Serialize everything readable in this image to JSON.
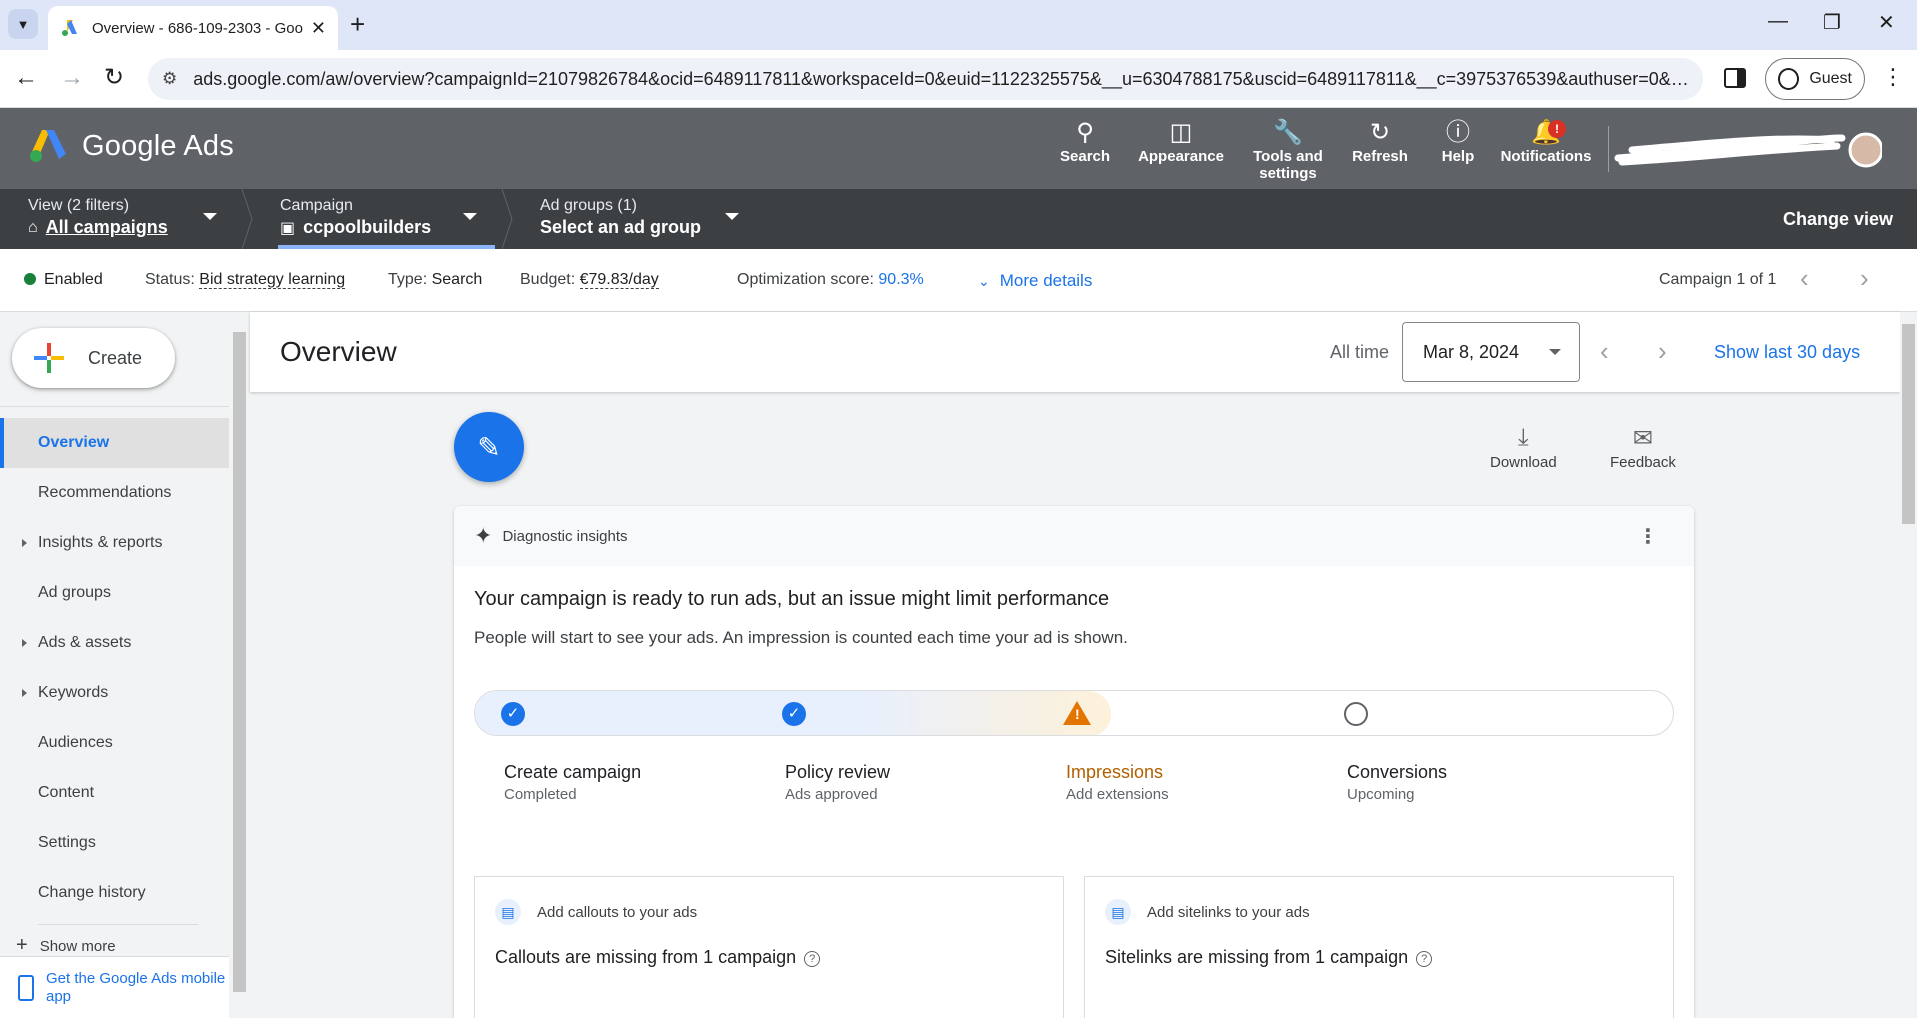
{
  "browser": {
    "tab_title": "Overview - 686-109-2303 - Goo",
    "url": "ads.google.com/aw/overview?campaignId=21079826784&ocid=6489117811&workspaceId=0&euid=1122325575&__u=6304788175&uscid=6489117811&__c=3975376539&authuser=0&sub...",
    "profile_label": "Guest"
  },
  "header": {
    "brand": "Google Ads",
    "items": [
      {
        "label": "Search",
        "icon": "search-icon"
      },
      {
        "label": "Appearance",
        "icon": "appearance-icon"
      },
      {
        "label": "Tools and settings",
        "icon": "wrench-icon"
      },
      {
        "label": "Refresh",
        "icon": "refresh-icon"
      },
      {
        "label": "Help",
        "icon": "help-icon"
      },
      {
        "label": "Notifications",
        "icon": "bell-icon",
        "badge": "!"
      }
    ]
  },
  "filters": {
    "view_label": "View (2 filters)",
    "view_value": "All campaigns",
    "campaign_label": "Campaign",
    "campaign_value": "ccpoolbuilders",
    "adgroups_label": "Ad groups (1)",
    "adgroups_value": "Select an ad group",
    "change_view": "Change view"
  },
  "status": {
    "enabled": "Enabled",
    "status_label": "Status:",
    "status_value": "Bid strategy learning",
    "type_label": "Type:",
    "type_value": "Search",
    "budget_label": "Budget:",
    "budget_value": "€79.83/day",
    "opt_label": "Optimization score:",
    "opt_value": "90.3%",
    "more_details": "More details",
    "campaign_pager": "Campaign 1 of 1"
  },
  "sidebar": {
    "create": "Create",
    "items": [
      {
        "label": "Overview",
        "active": true,
        "expandable": false
      },
      {
        "label": "Recommendations",
        "active": false,
        "expandable": false
      },
      {
        "label": "Insights & reports",
        "active": false,
        "expandable": true
      },
      {
        "label": "Ad groups",
        "active": false,
        "expandable": false
      },
      {
        "label": "Ads & assets",
        "active": false,
        "expandable": true
      },
      {
        "label": "Keywords",
        "active": false,
        "expandable": true
      },
      {
        "label": "Audiences",
        "active": false,
        "expandable": false
      },
      {
        "label": "Content",
        "active": false,
        "expandable": false
      },
      {
        "label": "Settings",
        "active": false,
        "expandable": false
      },
      {
        "label": "Change history",
        "active": false,
        "expandable": false
      }
    ],
    "show_more": "Show more",
    "get_app": "Get the Google Ads mobile app"
  },
  "main": {
    "title": "Overview",
    "range_label": "All time",
    "date": "Mar 8, 2024",
    "show_last": "Show last 30 days",
    "download": "Download",
    "feedback": "Feedback"
  },
  "insights": {
    "header": "Diagnostic insights",
    "headline": "Your campaign is ready to run ads, but an issue might limit performance",
    "subline": "People will start to see your ads. An impression is counted each time your ad is shown.",
    "steps": [
      {
        "title": "Create campaign",
        "sub": "Completed",
        "state": "done"
      },
      {
        "title": "Policy review",
        "sub": "Ads approved",
        "state": "done"
      },
      {
        "title": "Impressions",
        "sub": "Add extensions",
        "state": "warning"
      },
      {
        "title": "Conversions",
        "sub": "Upcoming",
        "state": "upcoming"
      }
    ],
    "cards": [
      {
        "header": "Add callouts to your ads",
        "body": "Callouts are missing from 1 campaign"
      },
      {
        "header": "Add sitelinks to your ads",
        "body": "Sitelinks are missing from 1 campaign"
      }
    ]
  },
  "colors": {
    "accent": "#1a73e8",
    "enabled_dot": "#188038",
    "warning": "#e37400",
    "header_bg": "#5f6368",
    "filter_bg": "#3c4043"
  }
}
